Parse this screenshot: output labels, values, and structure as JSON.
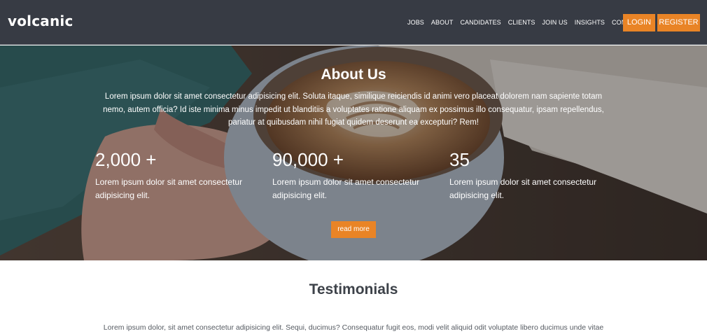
{
  "brand": {
    "logo_text": "volcanic"
  },
  "nav": {
    "items": [
      {
        "label": "JOBS"
      },
      {
        "label": "ABOUT"
      },
      {
        "label": "CANDIDATES"
      },
      {
        "label": "CLIENTS"
      },
      {
        "label": "JOIN US"
      },
      {
        "label": "INSIGHTS"
      },
      {
        "label": "CONTACT US"
      }
    ],
    "login_label": "LOGIN",
    "register_label": "REGISTER"
  },
  "hero": {
    "title": "About Us",
    "text": "Lorem ipsum dolor sit amet consectetur adipisicing elit. Soluta itaque, similique reiciendis id animi vero placeat dolorem nam sapiente totam nemo, autem officia? Id iste minima minus impedit ut blanditiis a voluptates ratione aliquam ex possimus illo consequatur, ipsam repellendus, pariatur at quibusdam nihil fugiat quidem deserunt ea excepturi? Rem!",
    "stats": [
      {
        "value": "2,000 +",
        "description": "Lorem ipsum dolor sit amet consectetur adipisicing elit."
      },
      {
        "value": "90,000 +",
        "description": "Lorem ipsum dolor sit amet consectetur adipisicing elit."
      },
      {
        "value": "35",
        "description": "Lorem ipsum dolor sit amet consectetur adipisicing elit."
      }
    ],
    "read_more_label": "read more"
  },
  "testimonials": {
    "title": "Testimonials",
    "text": "Lorem ipsum dolor, sit amet consectetur adipisicing elit. Sequi, ducimus? Consequatur fugit eos, modi velit aliquid odit voluptate libero ducimus unde vitae"
  },
  "colors": {
    "header_bg": "#373b44",
    "accent": "#e98426"
  }
}
